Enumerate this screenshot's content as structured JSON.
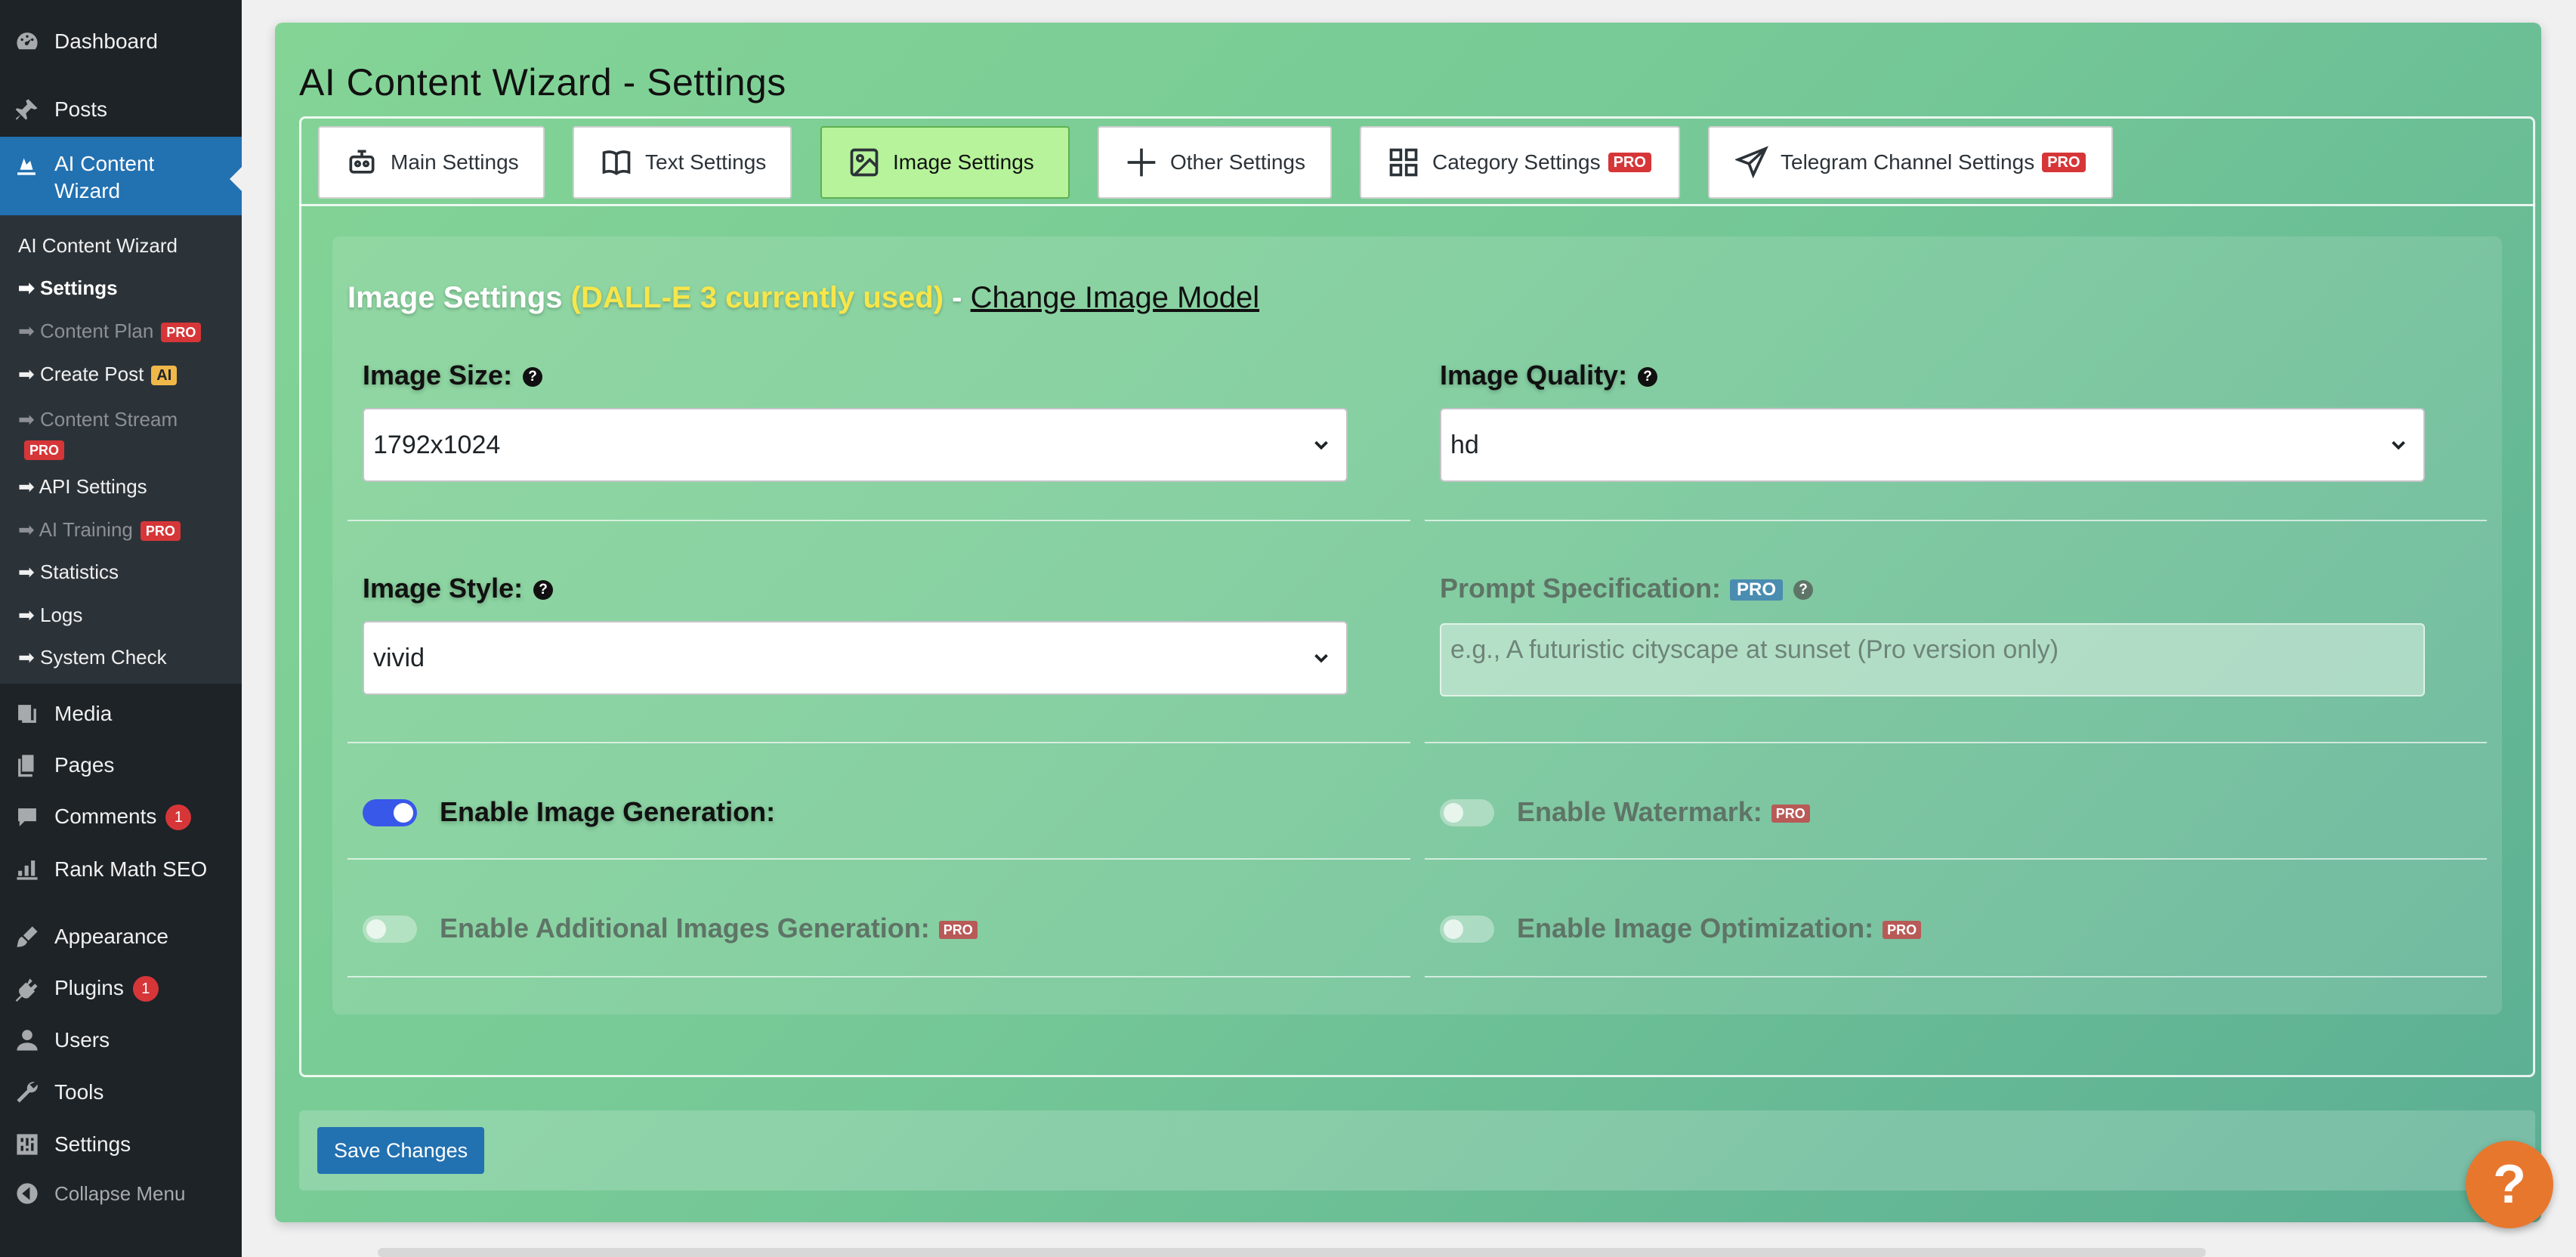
{
  "sidebar": {
    "items": [
      {
        "label": "Dashboard",
        "icon": "dashboard-icon"
      },
      {
        "label": "Posts",
        "icon": "pin-icon"
      },
      {
        "label": "AI Content Wizard",
        "icon": "wizard-icon"
      },
      {
        "label": "Media",
        "icon": "media-icon"
      },
      {
        "label": "Pages",
        "icon": "pages-icon"
      },
      {
        "label": "Comments",
        "icon": "comment-icon",
        "badge": "1"
      },
      {
        "label": "Rank Math SEO",
        "icon": "chart-icon"
      },
      {
        "label": "Appearance",
        "icon": "brush-icon"
      },
      {
        "label": "Plugins",
        "icon": "plug-icon",
        "badge": "1"
      },
      {
        "label": "Users",
        "icon": "user-icon"
      },
      {
        "label": "Tools",
        "icon": "wrench-icon"
      },
      {
        "label": "Settings",
        "icon": "sliders-icon"
      },
      {
        "label": "Collapse Menu",
        "icon": "collapse-icon"
      }
    ],
    "submenu": [
      {
        "label": "AI Content Wizard"
      },
      {
        "label": "➡ Settings"
      },
      {
        "label": "➡ Content Plan",
        "tag": "PRO"
      },
      {
        "label": "➡ Create Post",
        "tag": "AI"
      },
      {
        "label": "➡ Content Stream",
        "tag": "PRO"
      },
      {
        "label": "➡ API Settings"
      },
      {
        "label": "➡ AI Training",
        "tag": "PRO"
      },
      {
        "label": "➡ Statistics"
      },
      {
        "label": "➡ Logs"
      },
      {
        "label": "➡ System Check"
      }
    ]
  },
  "page": {
    "title": "AI Content Wizard - Settings"
  },
  "tabs": [
    {
      "label": "Main Settings",
      "icon": "robot-icon"
    },
    {
      "label": "Text Settings",
      "icon": "book-icon"
    },
    {
      "label": "Image Settings",
      "icon": "image-icon",
      "active": true
    },
    {
      "label": "Other Settings",
      "icon": "plus-icon"
    },
    {
      "label": "Category Settings",
      "icon": "grid-icon",
      "tag": "PRO"
    },
    {
      "label": "Telegram Channel Settings",
      "icon": "send-icon",
      "tag": "PRO"
    }
  ],
  "section": {
    "heading": "Image Settings",
    "model_note": "(DALL-E 3 currently used)",
    "dash": "-",
    "link": "Change Image Model"
  },
  "fields": {
    "image_size": {
      "label": "Image Size:",
      "value": "1792x1024"
    },
    "image_quality": {
      "label": "Image Quality:",
      "value": "hd"
    },
    "image_style": {
      "label": "Image Style:",
      "value": "vivid"
    },
    "prompt_spec": {
      "label": "Prompt Specification:",
      "tag": "PRO",
      "placeholder": "e.g., A futuristic cityscape at sunset (Pro version only)"
    }
  },
  "toggles": {
    "image_generation": {
      "label": "Enable Image Generation:",
      "on": true
    },
    "watermark": {
      "label": "Enable Watermark:",
      "tag": "PRO",
      "on": false
    },
    "additional_images": {
      "label": "Enable Additional Images Generation:",
      "tag": "PRO",
      "on": false
    },
    "optimization": {
      "label": "Enable Image Optimization:",
      "tag": "PRO",
      "on": false
    }
  },
  "actions": {
    "save_label": "Save Changes",
    "help_label": "?"
  },
  "colors": {
    "accent": "#2271b1",
    "active_tab": "#b6f39a",
    "panel_gradient_start": "#84d496",
    "panel_gradient_end": "#5bae94",
    "pro_badge": "#d63638",
    "heading_note": "#f7e64a",
    "help_button": "#e8772e"
  }
}
